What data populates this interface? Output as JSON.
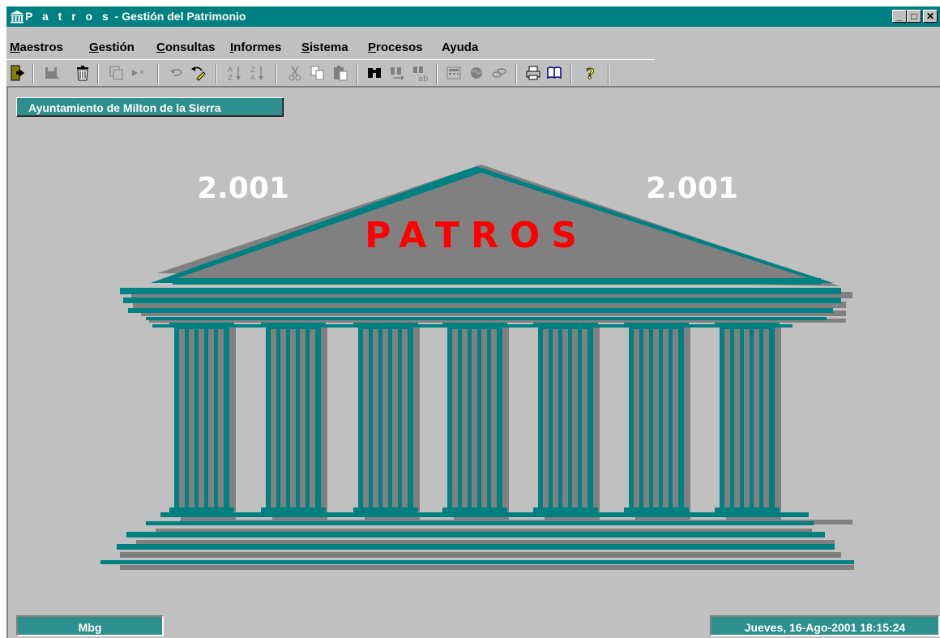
{
  "window": {
    "title_prefix": "P a t r o s",
    "title_suffix": " - Gestión del Patrimonio",
    "controls": {
      "minimize": "_",
      "maximize": "□",
      "close": "✕"
    }
  },
  "menu": [
    {
      "underline": "M",
      "rest": "aestros"
    },
    {
      "underline": "G",
      "rest": "estión"
    },
    {
      "underline": "C",
      "rest": "onsultas"
    },
    {
      "underline": "I",
      "rest": "nformes"
    },
    {
      "underline": "S",
      "rest": "istema"
    },
    {
      "underline": "P",
      "rest": "rocesos"
    },
    {
      "underline": "",
      "rest": "Ayuda"
    }
  ],
  "toolbar": {
    "icons": [
      "exit-icon",
      "save-icon",
      "delete-icon",
      "copy-record-icon",
      "new-record-icon",
      "undo-icon",
      "undo-all-icon",
      "sort-ascending-icon",
      "sort-descending-icon",
      "cut-icon",
      "copy-icon",
      "paste-icon",
      "find-icon",
      "find-next-icon",
      "replace-icon",
      "calculator-icon",
      "globe-icon",
      "link-icon",
      "print-icon",
      "book-icon",
      "help-icon"
    ]
  },
  "organization": "Ayuntamiento de Milton de la Sierra",
  "logo": {
    "year_left": "2.001",
    "year_right": "2.001",
    "brand": "PATROS",
    "colors": {
      "teal": "#008080",
      "gray": "#808080",
      "brand_red": "#ff0000"
    }
  },
  "status": {
    "user": "Mbg",
    "datetime": "Jueves, 16-Ago-2001 18:15:24"
  }
}
